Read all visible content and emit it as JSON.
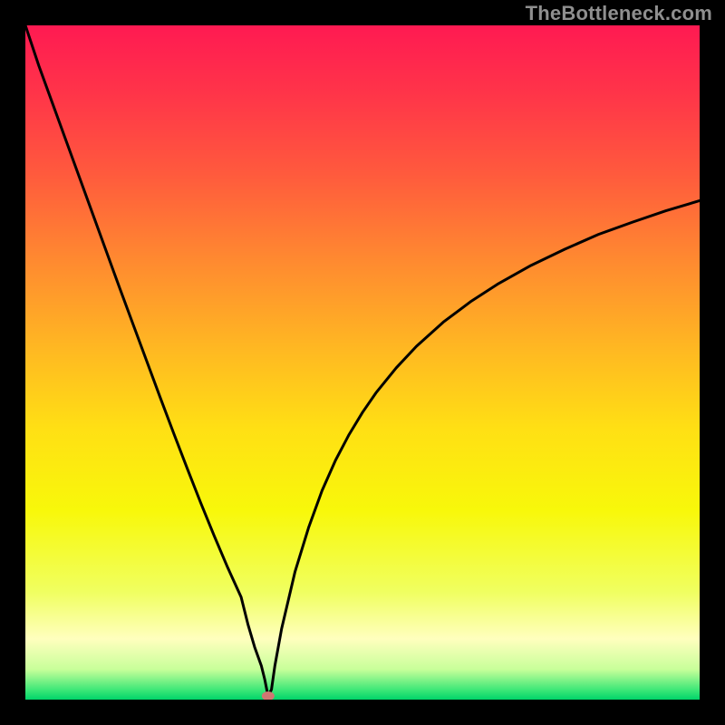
{
  "watermark": "TheBottleneck.com",
  "chart_data": {
    "type": "line",
    "title": "",
    "xlabel": "",
    "ylabel": "",
    "xlim": [
      0,
      100
    ],
    "ylim": [
      0,
      100
    ],
    "grid": false,
    "legend": false,
    "background": "rainbow-vertical-gradient",
    "marker": {
      "x": 36,
      "y": 0,
      "color": "#cf7772"
    },
    "series": [
      {
        "name": "curve",
        "color": "#000000",
        "x": [
          0,
          2,
          4,
          6,
          8,
          10,
          12,
          14,
          16,
          18,
          20,
          22,
          24,
          26,
          28,
          30,
          32,
          33,
          34,
          35,
          35.5,
          36,
          36.5,
          37,
          38,
          40,
          42,
          44,
          46,
          48,
          50,
          52,
          55,
          58,
          62,
          66,
          70,
          75,
          80,
          85,
          90,
          95,
          100
        ],
        "y": [
          100,
          94,
          88.5,
          83,
          77.5,
          72,
          66.5,
          61,
          55.6,
          50.2,
          44.8,
          39.5,
          34.3,
          29.2,
          24.3,
          19.6,
          15.2,
          11.2,
          7.8,
          5.0,
          3.0,
          0.5,
          1.5,
          5.0,
          10.5,
          19.0,
          25.5,
          31.0,
          35.5,
          39.3,
          42.6,
          45.5,
          49.2,
          52.4,
          56.0,
          59.0,
          61.6,
          64.4,
          66.8,
          69.0,
          70.8,
          72.5,
          74.0
        ]
      }
    ],
    "gradient_stops": [
      {
        "offset": 0.0,
        "color": "#ff1a52"
      },
      {
        "offset": 0.1,
        "color": "#ff3449"
      },
      {
        "offset": 0.22,
        "color": "#ff5a3d"
      },
      {
        "offset": 0.35,
        "color": "#ff8a30"
      },
      {
        "offset": 0.48,
        "color": "#ffb822"
      },
      {
        "offset": 0.6,
        "color": "#ffe014"
      },
      {
        "offset": 0.72,
        "color": "#f8f80a"
      },
      {
        "offset": 0.84,
        "color": "#f0ff60"
      },
      {
        "offset": 0.91,
        "color": "#ffffbe"
      },
      {
        "offset": 0.955,
        "color": "#c8ff9a"
      },
      {
        "offset": 0.985,
        "color": "#40e878"
      },
      {
        "offset": 1.0,
        "color": "#00d46a"
      }
    ]
  }
}
